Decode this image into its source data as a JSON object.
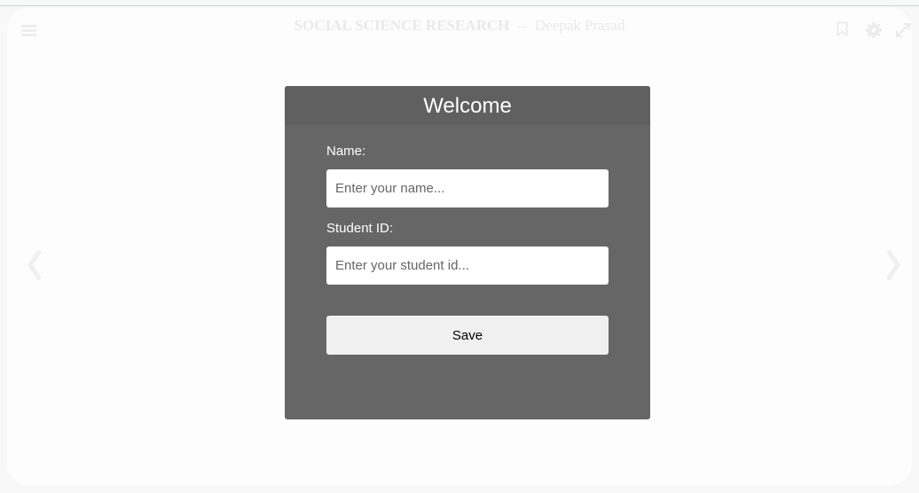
{
  "header": {
    "book_title": "SOCIAL SCIENCE RESEARCH",
    "separator": "–",
    "author": "Deepak Prasad"
  },
  "toolbar": {
    "menu_icon": "hamburger-menu-icon",
    "bookmark_icon": "bookmark-icon",
    "settings_icon": "gear-icon",
    "fullscreen_icon": "expand-icon"
  },
  "navigation": {
    "prev_icon": "chevron-left-icon",
    "next_icon": "chevron-right-icon"
  },
  "dialog": {
    "title": "Welcome",
    "name_label": "Name:",
    "name_placeholder": "Enter your name...",
    "name_value": "",
    "id_label": "Student ID:",
    "id_placeholder": "Enter your student id...",
    "id_value": "",
    "save_label": "Save"
  },
  "colors": {
    "dialog_background": "#666666",
    "dialog_header": "#606060",
    "button_background": "#f0f0f0"
  }
}
